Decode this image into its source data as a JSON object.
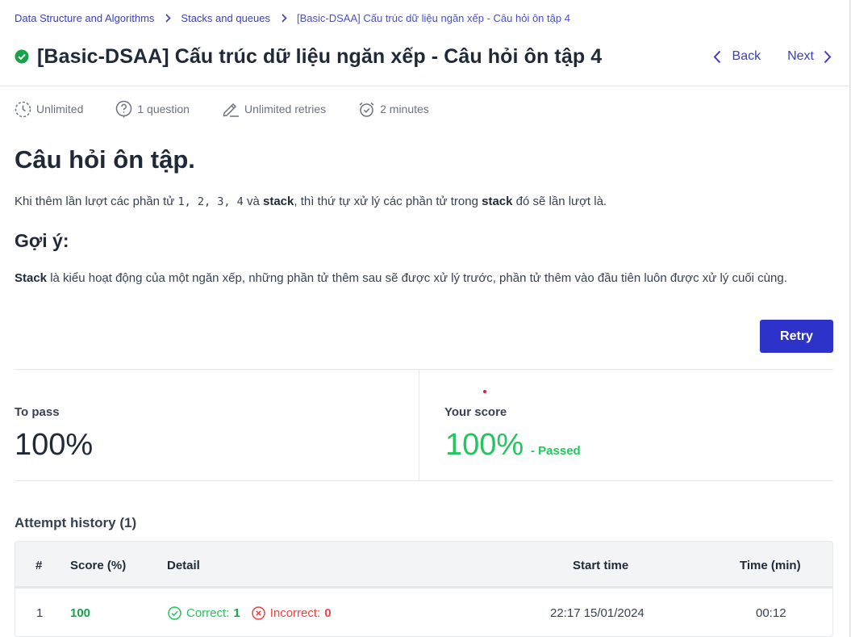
{
  "breadcrumb": {
    "items": [
      "Data Structure and Algorithms",
      "Stacks and queues",
      "[Basic-DSAA] Cấu trúc dữ liệu ngăn xếp - Câu hỏi ôn tập 4"
    ]
  },
  "header": {
    "title": "[Basic-DSAA] Cấu trúc dữ liệu ngăn xếp - Câu hỏi ôn tập 4",
    "back_label": "Back",
    "next_label": "Next"
  },
  "meta": {
    "time_limit": "Unlimited",
    "questions": "1 question",
    "retries": "Unlimited retries",
    "duration": "2 minutes"
  },
  "content": {
    "heading": "Câu hỏi ôn tập.",
    "question_p1": "Khi thêm lần lượt các phần tử ",
    "question_code": "1, 2, 3, 4",
    "question_p2": " và ",
    "question_bold1": "stack",
    "question_p3": ", thì thứ tự xử lý các phần tử trong ",
    "question_bold2": "stack",
    "question_p4": " đó sẽ lần lượt là.",
    "hint_heading": "Gợi ý:",
    "hint_bold": "Stack",
    "hint_text": " là kiểu hoạt động của một ngăn xếp, những phần tử thêm sau sẽ được xử lý trước, phần tử thêm vào đầu tiên luôn được xử lý cuối cùng."
  },
  "actions": {
    "retry_label": "Retry"
  },
  "score": {
    "to_pass_label": "To pass",
    "to_pass_value": "100%",
    "your_score_label": "Your score",
    "your_score_value": "100%",
    "status": "- Passed"
  },
  "history": {
    "title": "Attempt history (1)",
    "columns": [
      "#",
      "Score (%)",
      "Detail",
      "Start time",
      "Time (min)"
    ],
    "rows": [
      {
        "index": "1",
        "score": "100",
        "correct_label": "Correct:",
        "correct_count": "1",
        "incorrect_label": "Incorrect:",
        "incorrect_count": "0",
        "start_time": "22:17 15/01/2024",
        "time_min": "00:12"
      }
    ]
  },
  "colors": {
    "accent": "#2d32c9",
    "link": "#3b3fb8",
    "success": "#22c55e",
    "danger": "#ef4444"
  },
  "icons": {
    "status": "check-circle-icon",
    "back": "chevron-left-icon",
    "next": "chevron-right-icon",
    "time_limit": "clock-dashed-icon",
    "questions": "question-bubble-icon",
    "retries": "pencil-icon",
    "duration": "alarm-clock-icon",
    "correct": "check-circle-outline-icon",
    "incorrect": "x-circle-outline-icon"
  }
}
